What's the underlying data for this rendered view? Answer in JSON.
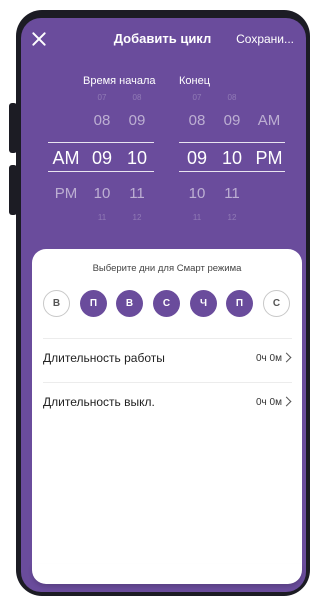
{
  "header": {
    "title": "Добавить цикл",
    "save_label": "Сохрани..."
  },
  "picker": {
    "start_label": "Время начала",
    "end_label": "Конец",
    "start": {
      "ampm": [
        "AM",
        "PM"
      ],
      "hours": [
        "07",
        "08",
        "09",
        "10",
        "11"
      ],
      "minutes": [
        "08",
        "09",
        "10",
        "11",
        "12"
      ]
    },
    "end": {
      "hours": [
        "07",
        "08",
        "09",
        "10",
        "11"
      ],
      "minutes": [
        "08",
        "09",
        "10",
        "11",
        "12"
      ],
      "ampm": [
        "AM",
        "PM"
      ]
    }
  },
  "smart": {
    "subtitle": "Выберите дни для Смарт режима",
    "days": [
      {
        "letter": "В",
        "selected": false
      },
      {
        "letter": "П",
        "selected": true
      },
      {
        "letter": "В",
        "selected": true
      },
      {
        "letter": "С",
        "selected": true
      },
      {
        "letter": "Ч",
        "selected": true
      },
      {
        "letter": "П",
        "selected": true
      },
      {
        "letter": "С",
        "selected": false
      }
    ]
  },
  "settings": {
    "work_duration_label": "Длительность работы",
    "work_duration_value": "0ч 0м",
    "off_duration_label": "Длительность выкл.",
    "off_duration_value": "0ч 0м"
  },
  "colors": {
    "accent": "#6a4c9c",
    "frame": "#1c1c24"
  }
}
